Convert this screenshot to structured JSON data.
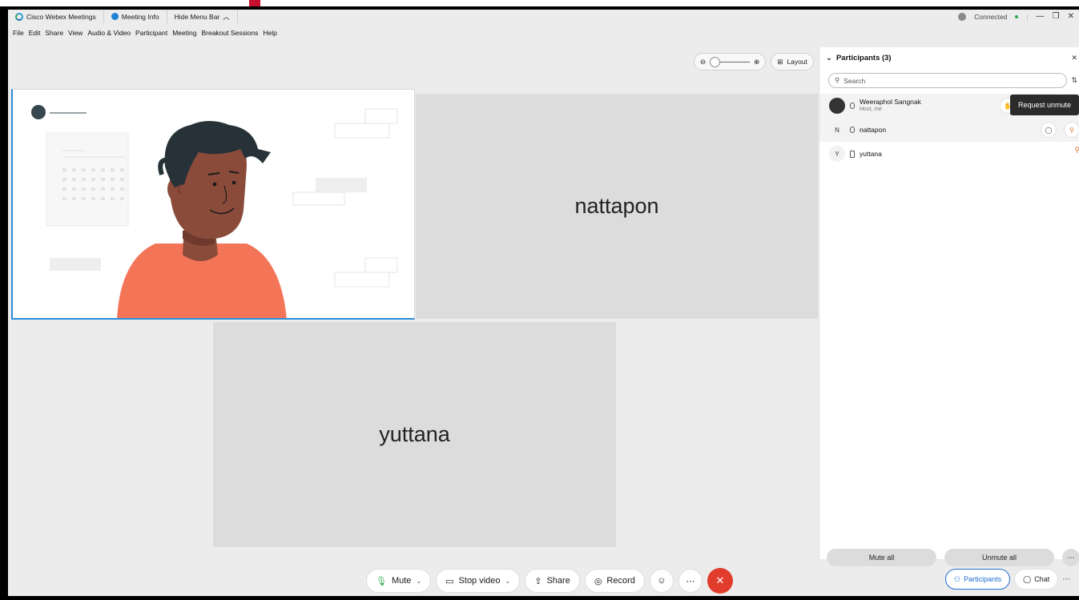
{
  "titlebar": {
    "app_name": "Cisco Webex Meetings",
    "meeting_info": "Meeting Info",
    "hide_menu_bar": "Hide Menu Bar",
    "status": "Connected"
  },
  "menu": [
    "File",
    "Edit",
    "Share",
    "View",
    "Audio & Video",
    "Participant",
    "Meeting",
    "Breakout Sessions",
    "Help"
  ],
  "view": {
    "layout_label": "Layout",
    "zoom_level": 0
  },
  "tiles": {
    "nattapon_label": "nattapon",
    "yuttana_label": "yuttana"
  },
  "controls": {
    "mute": "Mute",
    "stop_video": "Stop video",
    "share": "Share",
    "record": "Record"
  },
  "panel": {
    "title": "Participants (3)",
    "search_placeholder": "Search",
    "participants": [
      {
        "initial": "",
        "name": "Weeraphol Sangnak",
        "role": "Host, me"
      },
      {
        "initial": "N",
        "name": "nattapon",
        "role": ""
      },
      {
        "initial": "Y",
        "name": "yuttana",
        "role": ""
      }
    ],
    "tooltip": "Request unmute",
    "mute_all": "Mute all",
    "unmute_all": "Unmute all",
    "tabs": {
      "participants": "Participants",
      "chat": "Chat"
    }
  },
  "colors": {
    "accent": "#2a8ed8",
    "end_call": "#e23d2c",
    "person_shirt": "#f47458",
    "person_skin": "#8a4b3a",
    "person_hair": "#263238"
  }
}
